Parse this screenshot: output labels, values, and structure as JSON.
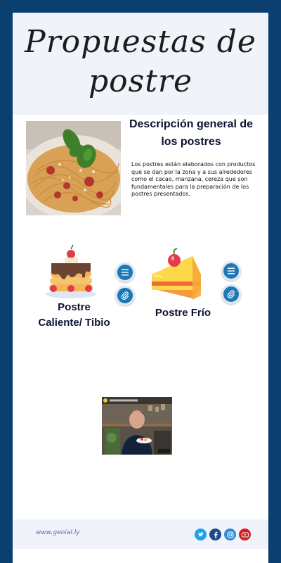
{
  "header": {
    "title_line1": "Propuestas de",
    "title_line2": "postre"
  },
  "overview": {
    "title": "Descripción general de los postres",
    "body": "Los postres están elaborados con productos que se dan por la zona y a sus alrededores como el cacao, manzana, cereza que son fundamentales para la preparación de los postres presentados."
  },
  "desserts": [
    {
      "label_line1": "Postre",
      "label_line2": "Caliente/ Tibio",
      "menu_icon": "list-icon",
      "attach_icon": "paperclip-icon"
    },
    {
      "label_line1": "Postre Frío",
      "menu_icon": "list-icon",
      "attach_icon": "paperclip-icon"
    }
  ],
  "footer": {
    "link": "www.genial.ly",
    "social": [
      "twitter-icon",
      "facebook-icon",
      "instagram-icon",
      "youtube-icon"
    ]
  },
  "colors": {
    "frame": "#0b3f70",
    "panel": "#f1f3fa",
    "button": "#1e78b6",
    "twitter": "#1da1f2",
    "facebook": "#1a4c8c",
    "instagram": "#2e8bd0",
    "youtube": "#d02020"
  }
}
